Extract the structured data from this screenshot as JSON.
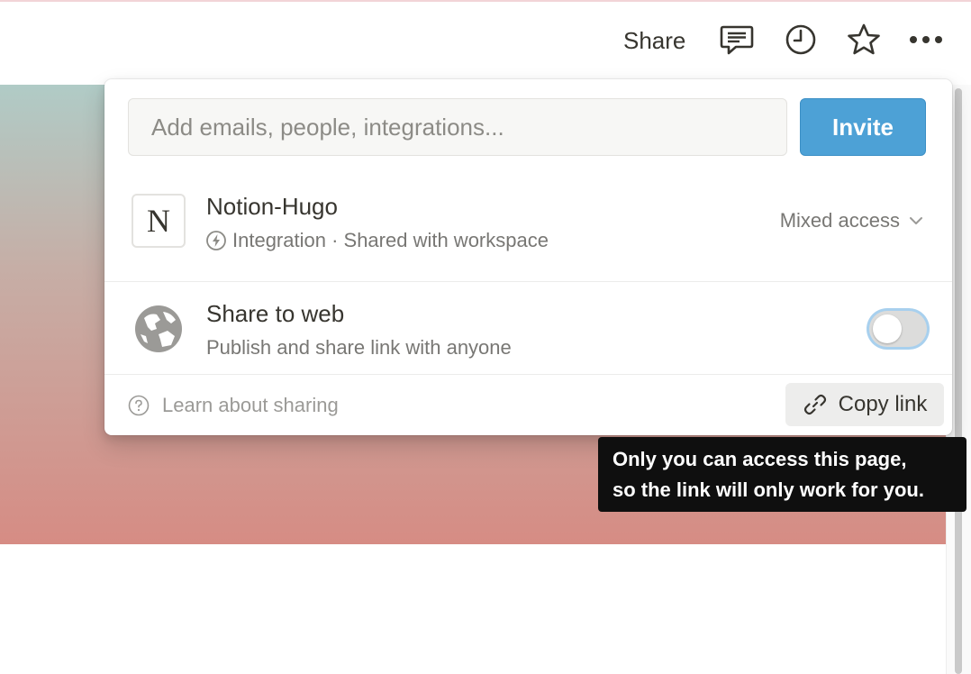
{
  "topbar": {
    "share_label": "Share",
    "icons": [
      "comment-icon",
      "clock-icon",
      "star-icon",
      "more-icon"
    ]
  },
  "share_popup": {
    "invite": {
      "placeholder": "Add emails, people, integrations...",
      "button_label": "Invite"
    },
    "integration": {
      "avatar_letter": "N",
      "name": "Notion-Hugo",
      "subtitle": "Integration · Shared with workspace",
      "access": "Mixed access"
    },
    "share_to_web": {
      "title": "Share to web",
      "subtitle": "Publish and share link with anyone",
      "enabled": false
    },
    "footer": {
      "learn_label": "Learn about sharing",
      "copy_link_label": "Copy link"
    }
  },
  "tooltip": {
    "line1": "Only you can access this page,",
    "line2": "so the link will only work for you."
  },
  "colors": {
    "invite_button": "#4da1d6",
    "tooltip_background": "#0f0f0f",
    "cover_top": "#b0cbc6",
    "cover_bottom": "#d68c84"
  }
}
